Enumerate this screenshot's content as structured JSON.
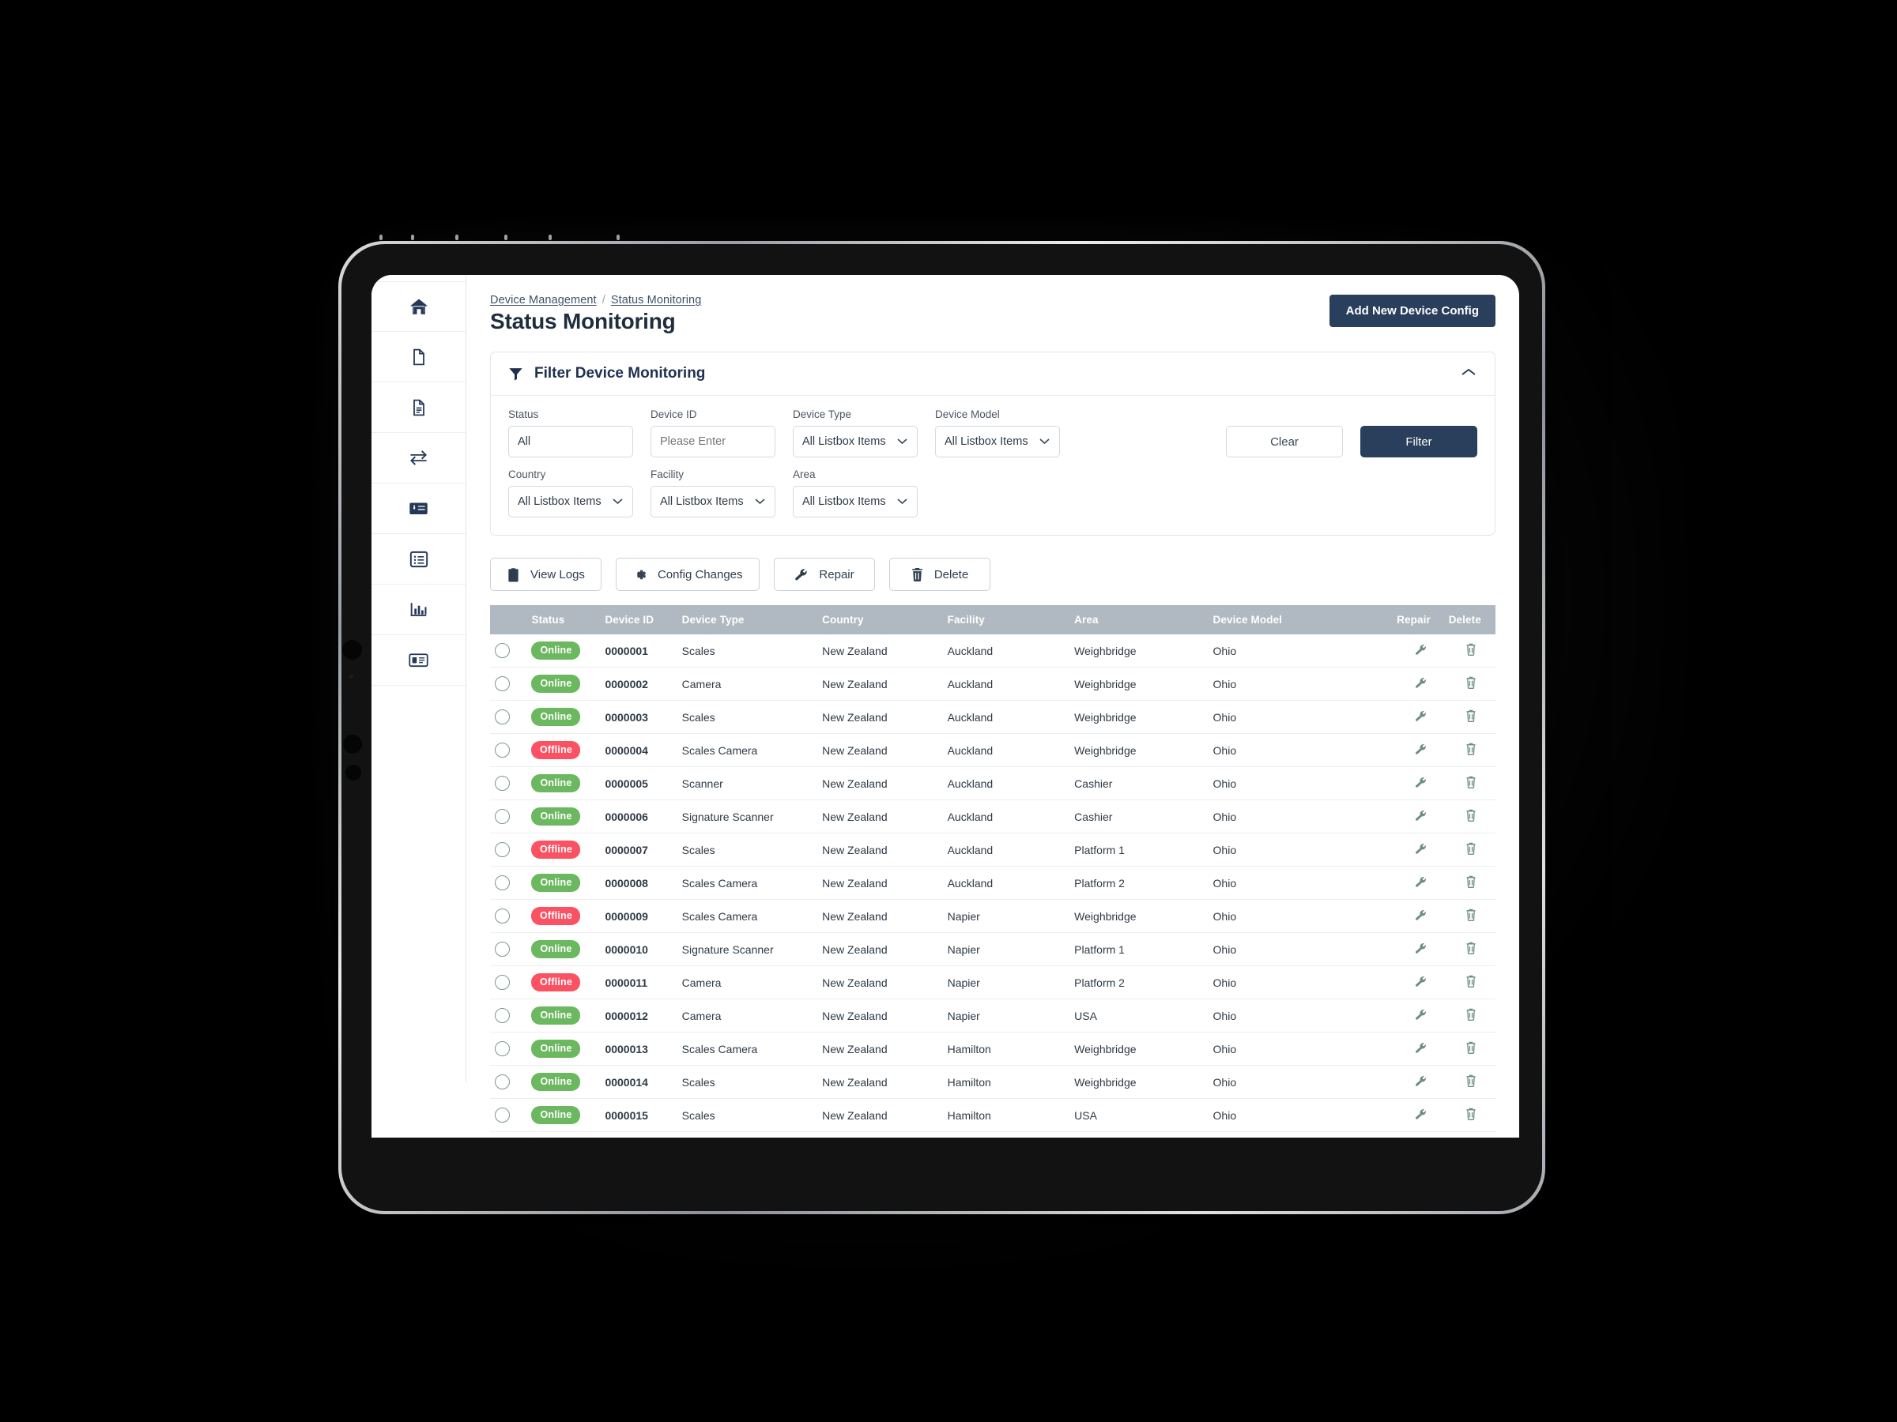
{
  "breadcrumb": {
    "parent": "Device Management",
    "separator": "/",
    "current": "Status Monitoring"
  },
  "header": {
    "page_title": "Status Monitoring",
    "add_button": "Add New Device Config"
  },
  "sidebar": {
    "items": [
      {
        "name": "home-icon"
      },
      {
        "name": "file-icon"
      },
      {
        "name": "file-lines-icon"
      },
      {
        "name": "transfer-arrows-icon"
      },
      {
        "name": "money-check-icon"
      },
      {
        "name": "list-alt-icon"
      },
      {
        "name": "chart-bar-icon"
      },
      {
        "name": "id-card-icon"
      }
    ]
  },
  "filter_panel": {
    "title": "Filter Device Monitoring",
    "collapse_icon": "chevron-up-icon",
    "fields": [
      {
        "label": "Status",
        "value": "All",
        "control": "select"
      },
      {
        "label": "Device ID",
        "value": "",
        "placeholder": "Please Enter",
        "control": "input"
      },
      {
        "label": "Device Type",
        "value": "All Listbox Items",
        "control": "listbox"
      },
      {
        "label": "Device  Model",
        "value": "All Listbox Items",
        "control": "listbox"
      },
      {
        "label": "Country",
        "value": "All Listbox Items",
        "control": "listbox"
      },
      {
        "label": "Facility",
        "value": "All Listbox Items",
        "control": "listbox"
      },
      {
        "label": "Area",
        "value": "All Listbox Items",
        "control": "listbox"
      }
    ],
    "clear_button": "Clear",
    "filter_button": "Filter"
  },
  "toolbar": {
    "buttons": [
      {
        "label": "View Logs",
        "icon": "clipboard-icon"
      },
      {
        "label": "Config Changes",
        "icon": "gear-icon"
      },
      {
        "label": "Repair",
        "icon": "wrench-icon"
      },
      {
        "label": "Delete",
        "icon": "trash-icon"
      }
    ]
  },
  "table": {
    "columns": [
      "",
      "Status",
      "Device ID",
      "Device Type",
      "Country",
      "Facility",
      "Area",
      "Device Model",
      "Repair",
      "Delete"
    ],
    "rows": [
      {
        "status": "Online",
        "device_id": "0000001",
        "device_type": "Scales",
        "country": "New Zealand",
        "facility": "Auckland",
        "area": "Weighbridge",
        "device_model": "Ohio"
      },
      {
        "status": "Online",
        "device_id": "0000002",
        "device_type": "Camera",
        "country": "New Zealand",
        "facility": "Auckland",
        "area": "Weighbridge",
        "device_model": "Ohio"
      },
      {
        "status": "Online",
        "device_id": "0000003",
        "device_type": "Scales",
        "country": "New Zealand",
        "facility": "Auckland",
        "area": "Weighbridge",
        "device_model": "Ohio"
      },
      {
        "status": "Offline",
        "device_id": "0000004",
        "device_type": "Scales Camera",
        "country": "New Zealand",
        "facility": "Auckland",
        "area": "Weighbridge",
        "device_model": "Ohio"
      },
      {
        "status": "Online",
        "device_id": "0000005",
        "device_type": "Scanner",
        "country": "New Zealand",
        "facility": "Auckland",
        "area": "Cashier",
        "device_model": "Ohio"
      },
      {
        "status": "Online",
        "device_id": "0000006",
        "device_type": "Signature Scanner",
        "country": "New Zealand",
        "facility": "Auckland",
        "area": "Cashier",
        "device_model": "Ohio"
      },
      {
        "status": "Offline",
        "device_id": "0000007",
        "device_type": "Scales",
        "country": "New Zealand",
        "facility": "Auckland",
        "area": "Platform 1",
        "device_model": "Ohio"
      },
      {
        "status": "Online",
        "device_id": "0000008",
        "device_type": "Scales Camera",
        "country": "New Zealand",
        "facility": "Auckland",
        "area": "Platform 2",
        "device_model": "Ohio"
      },
      {
        "status": "Offline",
        "device_id": "0000009",
        "device_type": "Scales Camera",
        "country": "New Zealand",
        "facility": "Napier",
        "area": "Weighbridge",
        "device_model": "Ohio"
      },
      {
        "status": "Online",
        "device_id": "0000010",
        "device_type": "Signature Scanner",
        "country": "New Zealand",
        "facility": "Napier",
        "area": "Platform 1",
        "device_model": "Ohio"
      },
      {
        "status": "Offline",
        "device_id": "0000011",
        "device_type": "Camera",
        "country": "New Zealand",
        "facility": "Napier",
        "area": "Platform 2",
        "device_model": "Ohio"
      },
      {
        "status": "Online",
        "device_id": "0000012",
        "device_type": "Camera",
        "country": "New Zealand",
        "facility": "Napier",
        "area": "USA",
        "device_model": "Ohio"
      },
      {
        "status": "Online",
        "device_id": "0000013",
        "device_type": "Scales Camera",
        "country": "New Zealand",
        "facility": "Hamilton",
        "area": "Weighbridge",
        "device_model": "Ohio"
      },
      {
        "status": "Online",
        "device_id": "0000014",
        "device_type": "Scales",
        "country": "New Zealand",
        "facility": "Hamilton",
        "area": "Weighbridge",
        "device_model": "Ohio"
      },
      {
        "status": "Online",
        "device_id": "0000015",
        "device_type": "Scales",
        "country": "New Zealand",
        "facility": "Hamilton",
        "area": "USA",
        "device_model": "Ohio"
      }
    ]
  },
  "colors": {
    "brand_navy": "#2a3f5c",
    "table_header": "#b0b9c2",
    "status_online": "#6cb860",
    "status_offline": "#fa5263",
    "row_icon": "#6d8e83"
  }
}
